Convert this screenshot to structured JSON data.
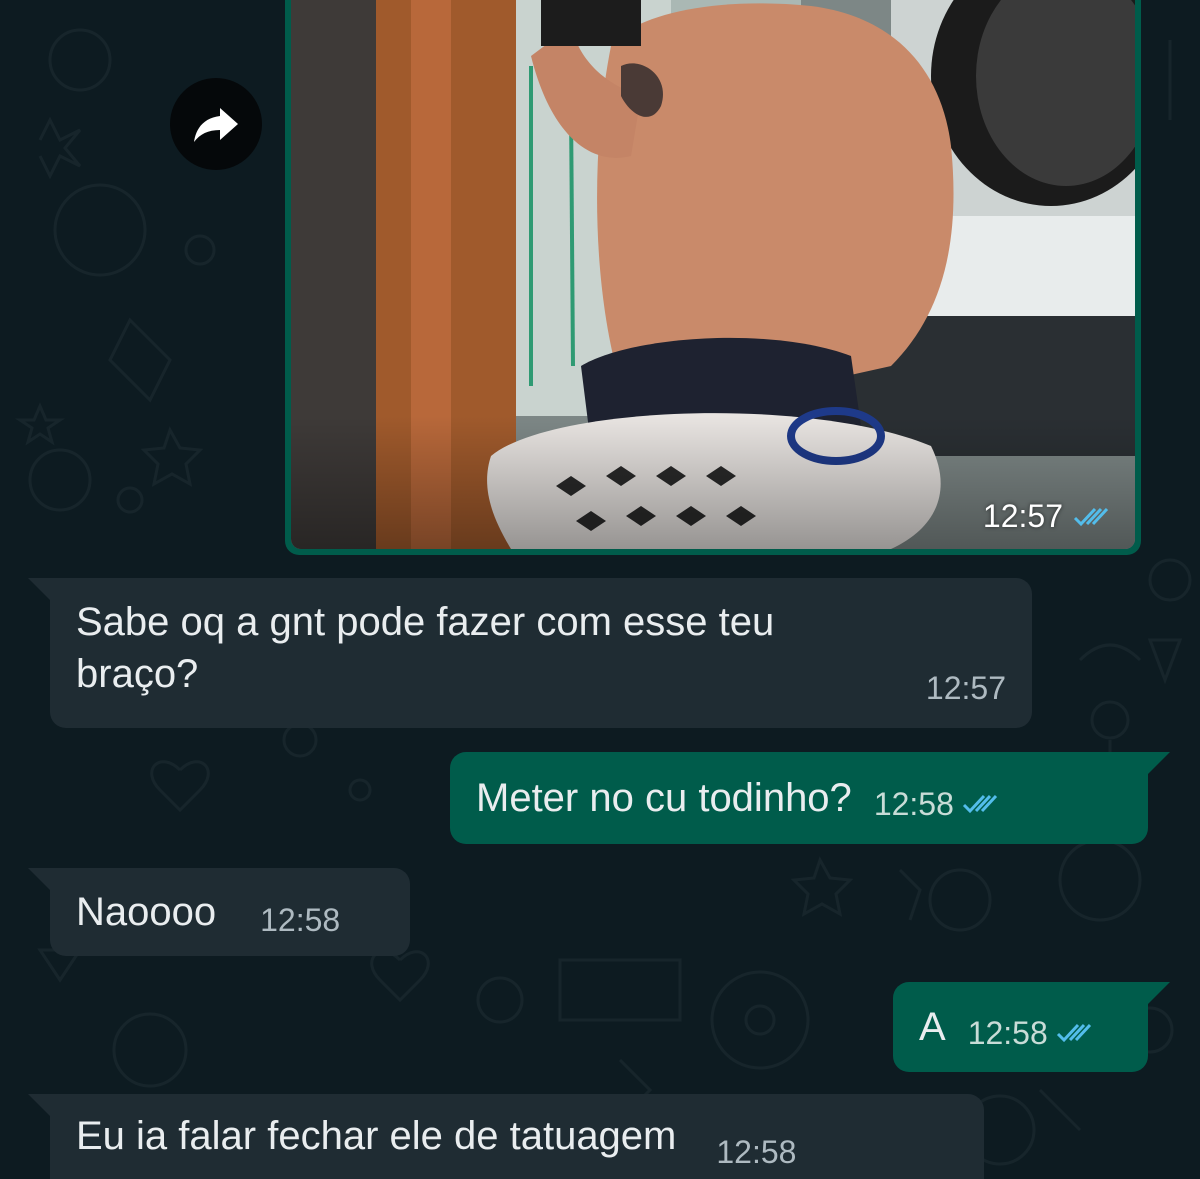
{
  "messages": {
    "image": {
      "time": "12:57",
      "status": "read",
      "forward_icon": "forward-icon"
    },
    "m1": {
      "text_line1": "Sabe oq a gnt pode fazer com esse teu",
      "text_line2": "braço?",
      "time": "12:57",
      "direction": "incoming"
    },
    "m2": {
      "text": "Meter no cu todinho?",
      "time": "12:58",
      "direction": "outgoing",
      "status": "read"
    },
    "m3": {
      "text": "Naoooo",
      "time": "12:58",
      "direction": "incoming"
    },
    "m4": {
      "text": "A",
      "time": "12:58",
      "direction": "outgoing",
      "status": "read"
    },
    "m5": {
      "text": "Eu ia falar fechar ele de tatuagem",
      "time": "12:58",
      "direction": "incoming"
    }
  },
  "colors": {
    "background": "#0d1b21",
    "incoming_bubble": "#1f2c33",
    "outgoing_bubble": "#005c4b",
    "read_ticks": "#53bdeb"
  }
}
